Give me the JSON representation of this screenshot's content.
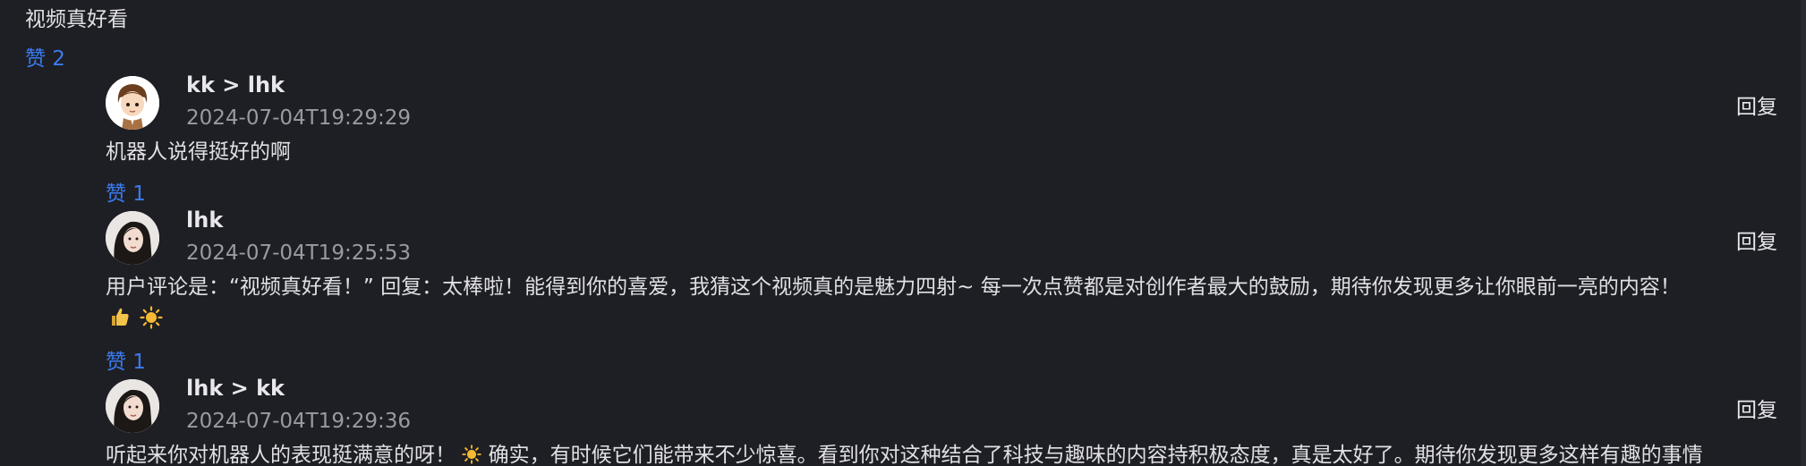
{
  "comment": {
    "text": "视频真好看",
    "like_label": "赞 2"
  },
  "replies": [
    {
      "name": "kk > lhk",
      "time": "2024-07-04T19:29:29",
      "reply_label": "回复",
      "content": "机器人说得挺好的啊",
      "like_label": "赞 1"
    },
    {
      "name": "lhk",
      "time": "2024-07-04T19:25:53",
      "reply_label": "回复",
      "content": "用户评论是：“视频真好看！” 回复：太棒啦！能得到你的喜爱，我猜这个视频真的是魅力四射~ 每一次点赞都是对创作者最大的鼓励，期待你发现更多让你眼前一亮的内容！",
      "emojis": [
        "thumbs-up-icon",
        "sun-icon"
      ],
      "like_label": "赞 1"
    },
    {
      "name": "lhk > kk",
      "time": "2024-07-04T19:29:36",
      "reply_label": "回复",
      "content_before_emoji": "听起来你对机器人的表现挺满意的呀！",
      "content_after_emoji": "确实，有时候它们能带来不少惊喜。看到你对这种结合了科技与趣味的内容持积极态度，真是太好了。期待你发现更多这样有趣的事情"
    }
  ],
  "colors": {
    "background": "#1e1f24",
    "like": "#3a7bf0",
    "time": "#9a9aa2"
  }
}
